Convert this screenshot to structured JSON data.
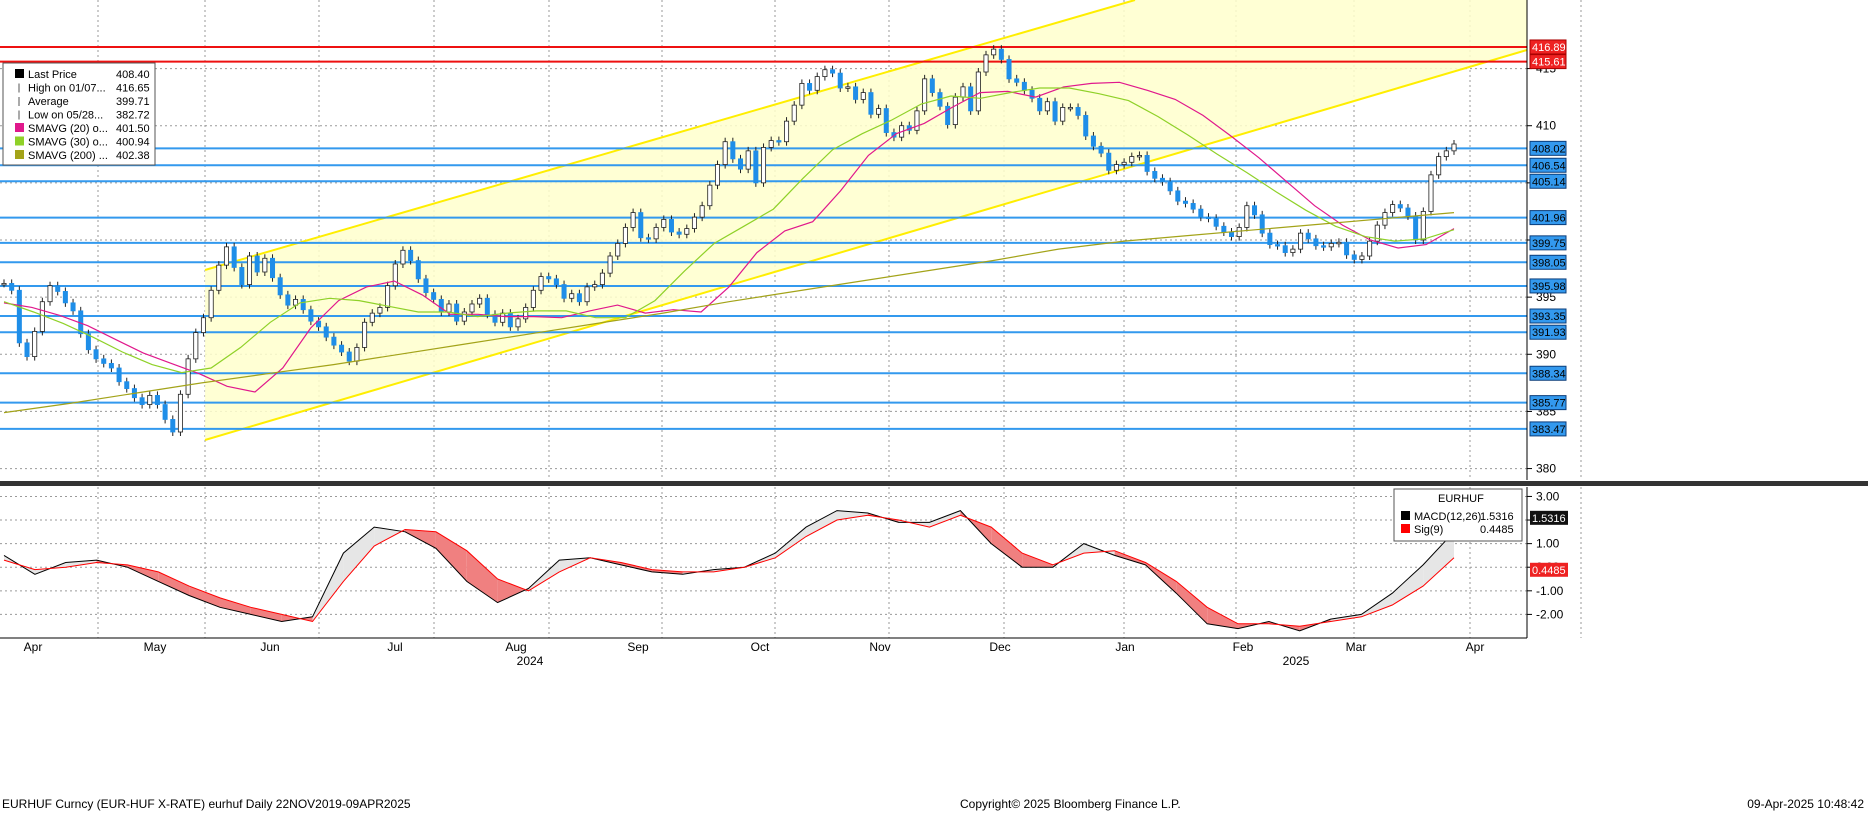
{
  "chart_data": [
    {
      "type": "line",
      "title": "EURHUF Curncy (EUR-HUF X-RATE) eurhuf  Daily 22NOV2019-09APR2025",
      "ylim": [
        379,
        421
      ],
      "y_ticks": [
        380,
        385,
        390,
        395,
        400,
        405,
        410,
        415
      ],
      "x_labels": [
        "Apr",
        "May",
        "Jun",
        "Jul",
        "Aug",
        "Sep",
        "Oct",
        "Nov",
        "Dec",
        "Jan",
        "Feb",
        "Mar",
        "Apr"
      ],
      "year_labels": [
        "2024",
        "2025"
      ],
      "legend": [
        {
          "label": "Last Price",
          "value": "408.40",
          "color": "#000000"
        },
        {
          "label": "High on 01/07...",
          "value": "416.65",
          "color": "#000000"
        },
        {
          "label": "Average",
          "value": "399.71",
          "color": "#000000"
        },
        {
          "label": "Low on 05/28...",
          "value": "382.72",
          "color": "#000000"
        },
        {
          "label": "SMAVG (20)   o...",
          "value": "401.50",
          "color": "#e0188c"
        },
        {
          "label": "SMAVG (30)   o...",
          "value": "400.94",
          "color": "#8fd128"
        },
        {
          "label": "SMAVG (200)  ...",
          "value": "402.38",
          "color": "#a3a319"
        }
      ],
      "red_levels": [
        416.89,
        415.61
      ],
      "blue_levels": [
        408.02,
        406.54,
        405.14,
        401.96,
        399.75,
        398.05,
        395.98,
        393.35,
        391.93,
        388.34,
        385.77,
        383.47
      ],
      "level_labels": [
        "416.89",
        "415.61",
        "408.02",
        "406.54",
        "405.14",
        "401.96",
        "399.75",
        "398.05",
        "395.98",
        "393.35",
        "391.93",
        "388.34",
        "385.77",
        "383.47"
      ],
      "series": [
        {
          "name": "Last Price",
          "values": [
            396.2,
            395.6,
            391.0,
            389.8,
            392.0,
            394.6,
            396.0,
            395.5,
            394.5,
            393.8,
            391.8,
            390.4,
            389.6,
            389.2,
            388.8,
            387.6,
            387.0,
            386.2,
            385.6,
            386.4,
            385.6,
            384.3,
            383.2,
            386.5,
            389.6,
            391.9,
            393.2,
            395.6,
            397.8,
            399.4,
            397.6,
            396.1,
            398.6,
            397.2,
            398.4,
            396.7,
            395.2,
            394.3,
            394.8,
            393.9,
            392.9,
            392.4,
            391.5,
            390.8,
            390.2,
            389.4,
            390.6,
            392.8,
            393.6,
            394.1,
            396.0,
            397.9,
            399.1,
            398.2,
            396.6,
            395.4,
            394.8,
            393.7,
            394.4,
            392.9,
            393.7,
            394.4,
            394.9,
            393.5,
            392.8,
            393.6,
            392.4,
            393.1,
            394.1,
            395.6,
            396.8,
            396.6,
            396.1,
            394.9,
            395.3,
            394.6,
            395.9,
            396.1,
            397.1,
            398.6,
            399.7,
            401.1,
            402.4,
            400.2,
            400.1,
            401.1,
            401.8,
            400.7,
            400.5,
            401.0,
            402.0,
            403.0,
            404.8,
            406.6,
            408.6,
            407.1,
            406.2,
            407.8,
            405.0,
            408.1,
            408.7,
            408.6,
            410.4,
            411.8,
            413.7,
            413.1,
            414.3,
            414.9,
            414.6,
            413.3,
            413.4,
            412.3,
            412.9,
            411.0,
            411.5,
            409.4,
            409.0,
            410.0,
            409.6,
            411.3,
            414.1,
            412.9,
            411.7,
            410.1,
            412.5,
            413.4,
            411.3,
            414.7,
            416.2,
            416.7,
            415.8,
            414.1,
            413.8,
            413.1,
            412.4,
            411.3,
            412.1,
            410.4,
            411.6,
            411.6,
            410.9,
            409.1,
            408.2,
            407.6,
            406.1,
            406.6,
            406.8,
            407.3,
            407.4,
            406.0,
            405.4,
            405.1,
            404.3,
            403.4,
            403.2,
            402.7,
            402.0,
            401.9,
            401.2,
            400.7,
            400.3,
            401.1,
            403.0,
            402.2,
            400.6,
            399.6,
            399.5,
            398.9,
            399.2,
            400.6,
            400.1,
            399.5,
            399.4,
            399.7,
            399.8,
            398.7,
            398.3,
            398.6,
            399.9,
            401.3,
            402.4,
            403.1,
            402.8,
            402.1,
            400.0,
            402.5,
            405.7,
            407.3,
            407.8,
            408.4
          ]
        },
        {
          "name": "SMAVG (20)",
          "values": [
            394.5,
            394.1,
            393.4,
            392.5,
            391.3,
            390.1,
            389.2,
            388.3,
            387.2,
            386.7,
            388.8,
            392.3,
            394.7,
            395.9,
            396.4,
            395.2,
            393.5,
            393.5,
            393.3,
            393.3,
            393.2,
            393.8,
            394.3,
            393.6,
            393.9,
            393.7,
            395.9,
            398.9,
            400.8,
            401.6,
            404.3,
            407.4,
            409.3,
            410.2,
            411.6,
            412.9,
            413.0,
            412.5,
            413.4,
            413.7,
            413.8,
            413.1,
            412.3,
            410.9,
            409.1,
            407.2,
            405.1,
            403.0,
            401.3,
            400.0,
            399.3,
            399.6,
            401.0
          ]
        },
        {
          "name": "SMAVG (30)",
          "values": [
            394.6,
            393.7,
            392.7,
            391.5,
            390.2,
            389.1,
            388.4,
            388.8,
            390.6,
            392.8,
            394.5,
            394.9,
            394.7,
            394.2,
            393.7,
            393.7,
            393.3,
            393.6,
            393.8,
            393.8,
            393.2,
            393.2,
            394.7,
            397.3,
            399.7,
            401.2,
            402.7,
            405.4,
            407.9,
            409.3,
            410.5,
            411.9,
            412.6,
            412.4,
            412.9,
            413.3,
            413.3,
            412.8,
            412.2,
            410.8,
            409.2,
            407.5,
            405.9,
            404.2,
            402.6,
            401.2,
            400.3,
            399.9,
            400.1,
            400.9
          ]
        },
        {
          "name": "SMAVG (200)",
          "values": [
            384.9,
            385.7,
            386.6,
            387.5,
            388.3,
            389.1,
            390.0,
            390.9,
            391.8,
            392.7,
            393.6,
            394.6,
            395.5,
            396.4,
            397.3,
            398.2,
            399.2,
            399.9,
            400.4,
            400.9,
            401.4,
            401.9,
            402.4
          ]
        }
      ]
    },
    {
      "type": "line",
      "ylim": [
        -3.0,
        3.4
      ],
      "y_ticks": [
        "3.00",
        "2.00",
        "1.00",
        "0.00",
        "-1.00",
        "-2.00"
      ],
      "legend_title": "EURHUF",
      "legend": [
        {
          "label": "MACD(12,26)",
          "value": "1.5316",
          "color": "#000000"
        },
        {
          "label": "Sig(9)",
          "value": "0.4485",
          "color": "#ff0000"
        }
      ],
      "value_labels": [
        "1.5316",
        "0.4485"
      ],
      "series": [
        {
          "name": "MACD(12,26)",
          "values": [
            0.5,
            -0.3,
            0.2,
            0.3,
            0.0,
            -0.6,
            -1.2,
            -1.7,
            -2.0,
            -2.3,
            -2.1,
            0.6,
            1.7,
            1.5,
            0.8,
            -0.6,
            -1.5,
            -0.9,
            0.3,
            0.4,
            0.1,
            -0.2,
            -0.3,
            -0.1,
            0.0,
            0.6,
            1.7,
            2.4,
            2.3,
            1.9,
            1.9,
            2.4,
            1.0,
            0.0,
            0.0,
            1.0,
            0.5,
            0.1,
            -1.1,
            -2.4,
            -2.6,
            -2.3,
            -2.7,
            -2.2,
            -2.0,
            -1.1,
            0.1,
            1.5
          ]
        },
        {
          "name": "Sig(9)",
          "values": [
            0.3,
            -0.1,
            0.0,
            0.2,
            0.1,
            -0.2,
            -0.8,
            -1.3,
            -1.7,
            -2.0,
            -2.3,
            -0.6,
            0.9,
            1.6,
            1.5,
            0.7,
            -0.5,
            -1.0,
            -0.2,
            0.4,
            0.2,
            -0.1,
            -0.2,
            -0.2,
            0.0,
            0.4,
            1.3,
            2.0,
            2.2,
            2.0,
            1.7,
            2.2,
            1.7,
            0.6,
            0.1,
            0.6,
            0.7,
            0.2,
            -0.6,
            -1.7,
            -2.4,
            -2.4,
            -2.5,
            -2.3,
            -2.1,
            -1.6,
            -0.8,
            0.4
          ]
        }
      ]
    }
  ],
  "footer": {
    "left": "EURHUF Curncy (EUR-HUF X-RATE) eurhuf  Daily 22NOV2019-09APR2025",
    "center": "Copyright© 2025 Bloomberg Finance L.P.",
    "right": "09-Apr-2025 10:48:42"
  }
}
